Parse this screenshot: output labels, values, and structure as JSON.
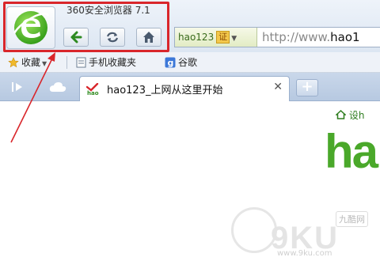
{
  "window": {
    "title": "360安全浏览器 7.1"
  },
  "toolbar": {
    "back_icon": "arrow-left-icon",
    "refresh_icon": "refresh-icon",
    "home_icon": "home-icon"
  },
  "address": {
    "site_badge": "hao123",
    "cert_label": "证",
    "url_prefix": "http://www.",
    "url_host": "hao1"
  },
  "favorites": {
    "items": [
      {
        "label": "收藏",
        "icon": "star-icon"
      },
      {
        "label": "手机收藏夹",
        "icon": "page-icon"
      },
      {
        "label": "谷歌",
        "icon": "google-icon"
      }
    ]
  },
  "tabs": [
    {
      "label": "hao123_上网从这里开始",
      "icon": "hao123-favicon"
    }
  ],
  "page": {
    "set_home_label": "设h",
    "brand_text": "ha",
    "watermark_logo": "九酷网",
    "watermark_text": "9KU",
    "watermark_url": "www.9ku.com"
  },
  "colors": {
    "highlight": "#d9262b",
    "brand_green": "#4aa82a"
  }
}
